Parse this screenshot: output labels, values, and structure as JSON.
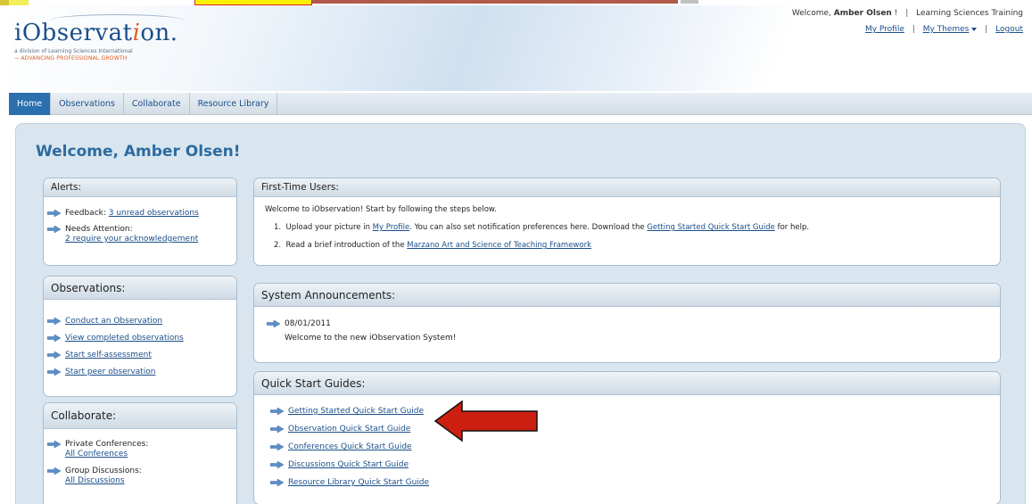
{
  "header": {
    "welcome_prefix": "Welcome, ",
    "user_name": "Amber Olsen",
    "welcome_suffix": " !",
    "organization": "Learning Sciences Training",
    "my_profile": "My Profile",
    "my_themes": "My Themes",
    "logout": "Logout",
    "logo": {
      "name_part1": "iObservat",
      "name_accent": "i",
      "name_part2": "on.",
      "subtitle": "a division of Learning Sciences International",
      "tagline": "ADVANCING PROFESSIONAL GROWTH"
    }
  },
  "nav": {
    "tabs": [
      {
        "label": "Home"
      },
      {
        "label": "Observations"
      },
      {
        "label": "Collaborate"
      },
      {
        "label": "Resource Library"
      }
    ]
  },
  "main": {
    "welcome_heading": "Welcome, Amber Olsen!",
    "alerts": {
      "title": "Alerts:",
      "feedback_label": "Feedback: ",
      "feedback_link": "3 unread observations",
      "needs_attention_label": "Needs Attention:",
      "needs_attention_link": "2 require your acknowledgement"
    },
    "observations": {
      "title": "Observations:",
      "links": [
        "Conduct an Observation",
        "View completed observations",
        "Start self-assessment",
        "Start peer observation"
      ]
    },
    "collaborate": {
      "title": "Collaborate:",
      "private_label": "Private Conferences:",
      "private_link": "All Conferences",
      "group_label": "Group Discussions:",
      "group_link": "All Discussions"
    },
    "first_time": {
      "title": "First-Time Users:",
      "intro": "Welcome to iObservation! Start by following the steps below.",
      "step1_num": "1.",
      "step1_a": "Upload your picture in ",
      "step1_link1": "My Profile",
      "step1_b": ". You can also set notification preferences here. Download the ",
      "step1_link2": "Getting Started Quick Start Guide",
      "step1_c": " for help.",
      "step2_num": "2.",
      "step2_a": "Read a brief introduction of the ",
      "step2_link": "Marzano Art and Science of Teaching Framework"
    },
    "announcements": {
      "title": "System Announcements:",
      "date": "08/01/2011",
      "text": "Welcome to the new iObservation System!"
    },
    "quick_start": {
      "title": "Quick Start Guides:",
      "links": [
        "Getting Started Quick Start Guide",
        "Observation Quick Start Guide",
        "Conferences Quick Start Guide",
        "Discussions Quick Start Guide",
        "Resource Library Quick Start Guide"
      ]
    }
  },
  "colors": {
    "brand_blue": "#1a4f8a",
    "heading_blue": "#2d6b9f",
    "active_tab": "#2a6fae",
    "accent_orange": "#e45c1e",
    "annotation_red": "#cc1f10"
  },
  "icons": {
    "bullet": "blue-right-arrow-icon",
    "annotation": "red-pointer-arrow"
  }
}
